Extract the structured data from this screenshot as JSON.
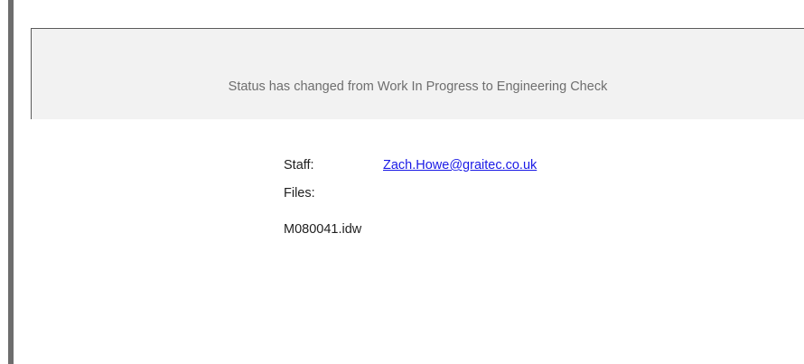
{
  "status_banner": {
    "message": "Status has changed from Work In Progress to Engineering Check"
  },
  "details": {
    "staff_label": "Staff:",
    "staff_email": "Zach.Howe@graitec.co.uk",
    "files_label": "Files:",
    "files": [
      "M080041.idw"
    ]
  },
  "colors": {
    "banner_background": "#f2f2f2",
    "banner_text": "#6e6e6e",
    "link": "#1a1ae6",
    "left_bar": "#6d6d6d"
  }
}
